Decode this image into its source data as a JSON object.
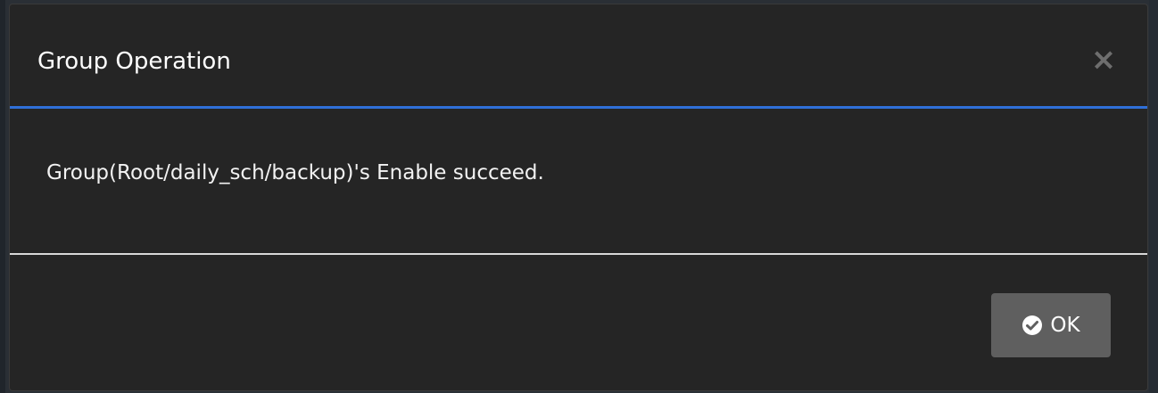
{
  "dialog": {
    "title": "Group Operation",
    "close_label": "×",
    "message": "Group(Root/daily_sch/backup)'s Enable succeed.",
    "ok_label": "OK",
    "ok_icon": "check-circle-icon",
    "close_icon": "close-icon"
  },
  "colors": {
    "background": "#252525",
    "header_border": "#2f6fd8",
    "body_border": "#d8d8d8",
    "button_bg": "#5f5f5f",
    "text": "#ffffff",
    "close_icon": "#6e6e6e"
  }
}
